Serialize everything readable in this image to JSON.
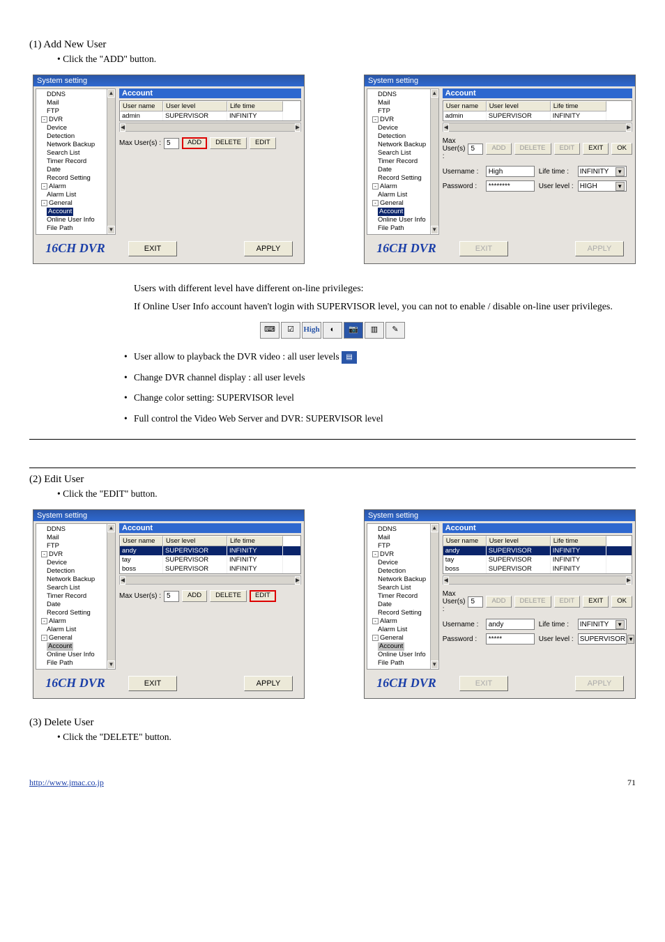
{
  "section1": {
    "title": "(1) Add New User",
    "step": "• Click the \"ADD\" button.",
    "window_title": "System setting",
    "pane_title": "Account",
    "brand": "16CH DVR",
    "tree_items_a": [
      "DDNS",
      "Mail",
      "FTP",
      "DVR",
      "Device",
      "Detection",
      "Network Backup",
      "Search List",
      "Timer Record",
      "Date",
      "Record Setting",
      "Alarm",
      "Alarm List",
      "General",
      "Account",
      "Online User Info",
      "File Path"
    ],
    "grid_head": [
      "User name",
      "User level",
      "Life time"
    ],
    "grid_row1": [
      "admin",
      "SUPERVISOR",
      "INFINITY"
    ],
    "maxusers_label": "Max User(s) :",
    "maxusers_val": "5",
    "btn_add": "ADD",
    "btn_del": "DELETE",
    "btn_edit": "EDIT",
    "btn_exit": "EXIT",
    "btn_ok": "OK",
    "exit_btn": "EXIT",
    "apply_btn": "APPLY",
    "form": {
      "user_lbl": "Username :",
      "user_val": "High",
      "life_lbl": "Life time :",
      "life_val": "INFINITY",
      "pass_lbl": "Password :",
      "pass_val": "********",
      "lvl_lbl": "User level :",
      "lvl_val": "HIGH"
    }
  },
  "info": {
    "p1": "Users with different level have different on-line privileges:",
    "p2": "If Online User Info account haven't login with SUPERVISOR level, you can not to enable / disable on-line user privileges.",
    "icons": [
      "⌨",
      "☑",
      "High",
      "◐",
      "📷",
      "▥",
      "✎"
    ],
    "li1": "User allow to playback the DVR video   : all user levels",
    "li2": "Change DVR channel display : all user levels",
    "li3": "Change color setting: SUPERVISOR level",
    "li4": "Full control the Video Web Server and DVR: SUPERVISOR level",
    "pb_icon": "▤"
  },
  "section2": {
    "title": "(2) Edit User",
    "step": "• Click the \"EDIT\" button.",
    "grid_rows": [
      [
        "andy",
        "SUPERVISOR",
        "INFINITY"
      ],
      [
        "tay",
        "SUPERVISOR",
        "INFINITY"
      ],
      [
        "boss",
        "SUPERVISOR",
        "INFINITY"
      ]
    ],
    "form": {
      "user_val": "andy",
      "life_val": "INFINITY",
      "pass_val": "*****",
      "lvl_val": "SUPERVISOR"
    }
  },
  "section3": {
    "title": "(3) Delete User",
    "step": "• Click the \"DELETE\" button."
  },
  "footer": {
    "link": "http://www.jmac.co.jp",
    "page": "71"
  }
}
